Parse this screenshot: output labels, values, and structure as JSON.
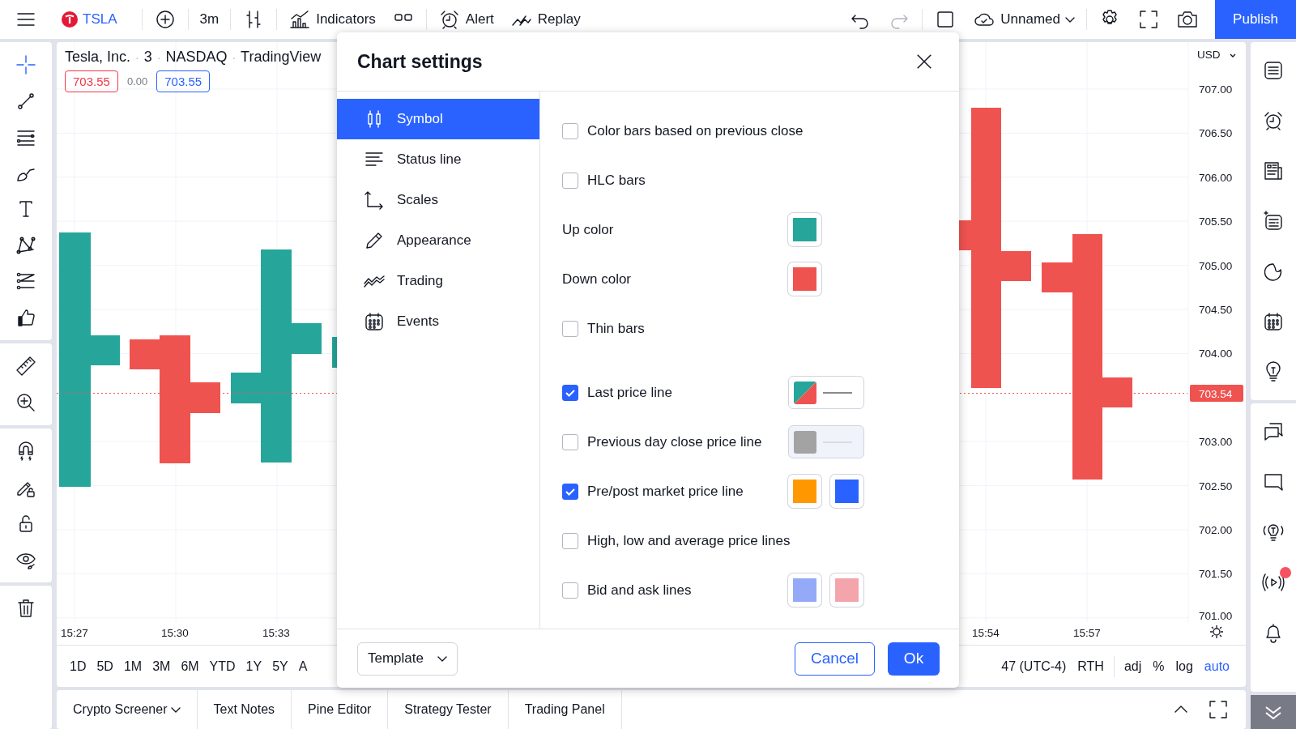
{
  "top_bar": {
    "symbol": "TSLA",
    "interval": "3m",
    "indicators": "Indicators",
    "alert": "Alert",
    "replay": "Replay",
    "layout_name": "Unnamed",
    "publish": "Publish"
  },
  "legend": {
    "separator": "·",
    "title_parts": [
      "Tesla, Inc.",
      "3",
      "NASDAQ",
      "TradingView"
    ],
    "values": [
      {
        "text": "703.55",
        "kind": "sell"
      },
      {
        "text": "0.00",
        "kind": "spread"
      },
      {
        "text": "703.55",
        "kind": "buy"
      }
    ]
  },
  "price_axis": {
    "currency": "USD",
    "ticks": [
      "707.00",
      "706.50",
      "706.00",
      "705.50",
      "705.00",
      "704.50",
      "704.00",
      "703.00",
      "702.50",
      "702.00",
      "701.50",
      "701.00"
    ],
    "last_price": "703.54"
  },
  "time_axis": {
    "left_labels": [
      "15:27",
      "15:30",
      "15:33"
    ],
    "right_labels": [
      "15:54",
      "15:57"
    ]
  },
  "timeframes": [
    "1D",
    "5D",
    "1M",
    "3M",
    "6M",
    "YTD",
    "1Y",
    "5Y",
    "A"
  ],
  "session": {
    "timezone": "47 (UTC-4)",
    "session": "RTH",
    "options": [
      {
        "label": "adj",
        "selected": false
      },
      {
        "label": "%",
        "selected": false
      },
      {
        "label": "log",
        "selected": false
      },
      {
        "label": "auto",
        "selected": true
      }
    ]
  },
  "bottom_tabs": [
    {
      "label": "Crypto Screener",
      "has_menu": true
    },
    {
      "label": "Text Notes",
      "has_menu": false
    },
    {
      "label": "Pine Editor",
      "has_menu": false
    },
    {
      "label": "Strategy Tester",
      "has_menu": false
    },
    {
      "label": "Trading Panel",
      "has_menu": false
    }
  ],
  "dialog": {
    "title": "Chart settings",
    "menu": [
      {
        "label": "Symbol",
        "selected": true
      },
      {
        "label": "Status line",
        "selected": false
      },
      {
        "label": "Scales",
        "selected": false
      },
      {
        "label": "Appearance",
        "selected": false
      },
      {
        "label": "Trading",
        "selected": false
      },
      {
        "label": "Events",
        "selected": false
      }
    ],
    "sections": [
      {
        "rows": [
          {
            "kind": "checkbox",
            "label": "Color bars based on previous close",
            "checked": false,
            "swatches": []
          },
          {
            "kind": "checkbox",
            "label": "HLC bars",
            "checked": false,
            "swatches": []
          },
          {
            "kind": "color",
            "label": "Up color",
            "swatches": [
              {
                "kind": "color",
                "color": "#26a69a"
              }
            ]
          },
          {
            "kind": "color",
            "label": "Down color",
            "swatches": [
              {
                "kind": "color",
                "color": "#ef5350"
              }
            ]
          },
          {
            "kind": "checkbox",
            "label": "Thin bars",
            "checked": false,
            "swatches": []
          }
        ]
      },
      {
        "rows": [
          {
            "kind": "checkbox",
            "label": "Last price line",
            "checked": true,
            "swatches": [
              {
                "kind": "split_line"
              }
            ]
          },
          {
            "kind": "checkbox",
            "label": "Previous day close price line",
            "checked": false,
            "swatches": [
              {
                "kind": "color_line",
                "color": "#a3a3a3"
              }
            ]
          },
          {
            "kind": "checkbox",
            "label": "Pre/post market price line",
            "checked": true,
            "swatches": [
              {
                "kind": "color",
                "color": "#ff9800"
              },
              {
                "kind": "color",
                "color": "#2962ff"
              }
            ]
          },
          {
            "kind": "checkbox",
            "label": "High, low and average price lines",
            "checked": false,
            "swatches": []
          },
          {
            "kind": "checkbox",
            "label": "Bid and ask lines",
            "checked": false,
            "swatches": [
              {
                "kind": "color",
                "color": "#94aaf8"
              },
              {
                "kind": "color",
                "color": "#f3a5ab"
              }
            ]
          }
        ]
      }
    ],
    "template": "Template",
    "cancel": "Cancel",
    "ok": "Ok"
  }
}
